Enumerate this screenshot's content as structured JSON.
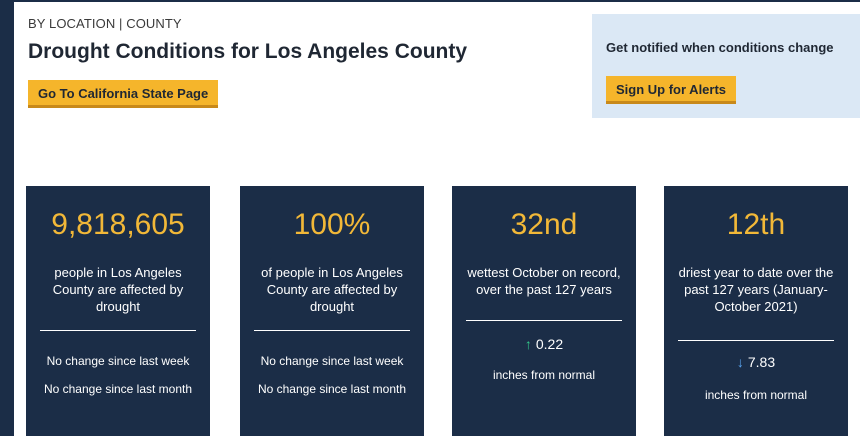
{
  "breadcrumb": "BY LOCATION | COUNTY",
  "title": "Drought Conditions for Los Angeles County",
  "state_button": "Go To California State Page",
  "notify": {
    "text": "Get notified when conditions change",
    "button": "Sign Up for Alerts"
  },
  "colors": {
    "card_bg": "#1b2d47",
    "accent_yellow": "#f2b838",
    "button_yellow": "#f5b52b",
    "notify_bg": "#dbe8f5",
    "arrow_up": "#31c98a",
    "arrow_down": "#5aa6f2"
  },
  "cards": [
    {
      "value": "9,818,605",
      "description": "people in Los Angeles County are affected by drought",
      "line1": "No change since last week",
      "line2": "No change since last month"
    },
    {
      "value": "100%",
      "description": "of people in Los Angeles County are affected by drought",
      "line1": "No change since last week",
      "line2": "No change since last month"
    },
    {
      "value": "32nd",
      "description": "wettest October on record, over the past 127 years",
      "delta_icon": "arrow-up-icon",
      "delta": "0.22",
      "unit": "inches from normal"
    },
    {
      "value": "12th",
      "description": "driest year to date over the past 127 years (January-October 2021)",
      "delta_icon": "arrow-down-icon",
      "delta": "7.83",
      "unit": "inches from normal"
    }
  ]
}
